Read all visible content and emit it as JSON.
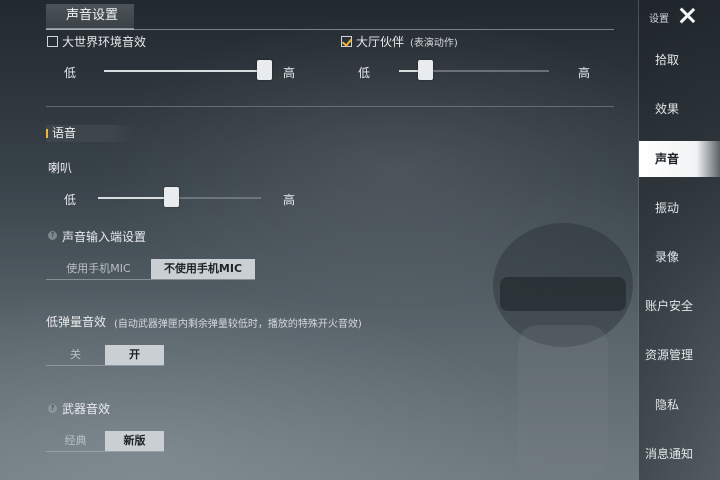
{
  "section_tab": "声音设置",
  "world_sound": {
    "label": "大世界环境音效",
    "checked": false,
    "low": "低",
    "high": "高",
    "value": 0.98
  },
  "lobby_partner": {
    "label": "大厅伙伴",
    "note": "(表演动作)",
    "checked": true,
    "low": "低",
    "high": "高",
    "value": 0.17
  },
  "voice": {
    "title": "语音",
    "speaker": {
      "label": "喇叭",
      "low": "低",
      "high": "高",
      "value": 0.45
    }
  },
  "mic_input": {
    "help": "?",
    "title": "声音输入端设置",
    "options": [
      "使用手机MIC",
      "不使用手机MIC"
    ],
    "selected": "不使用手机MIC"
  },
  "low_ammo": {
    "title": "低弹量音效",
    "note": "(自动武器弹匣内剩余弹量较低时，播放的特殊开火音效)",
    "options": [
      "关",
      "开"
    ],
    "selected": "开"
  },
  "weapon_sound": {
    "help": "?",
    "title": "武器音效",
    "options": [
      "经典",
      "新版"
    ],
    "selected": "新版"
  },
  "sidebar": {
    "title": "设置",
    "items": [
      {
        "label": "拾取"
      },
      {
        "label": "效果"
      },
      {
        "label": "声音",
        "active": true
      },
      {
        "label": "振动"
      },
      {
        "label": "录像"
      },
      {
        "label": "账户安全"
      },
      {
        "label": "资源管理"
      },
      {
        "label": "隐私"
      },
      {
        "label": "消息通知"
      }
    ]
  },
  "colors": {
    "accent": "#f0b53b",
    "active_tab_bg": "#ffffff"
  }
}
